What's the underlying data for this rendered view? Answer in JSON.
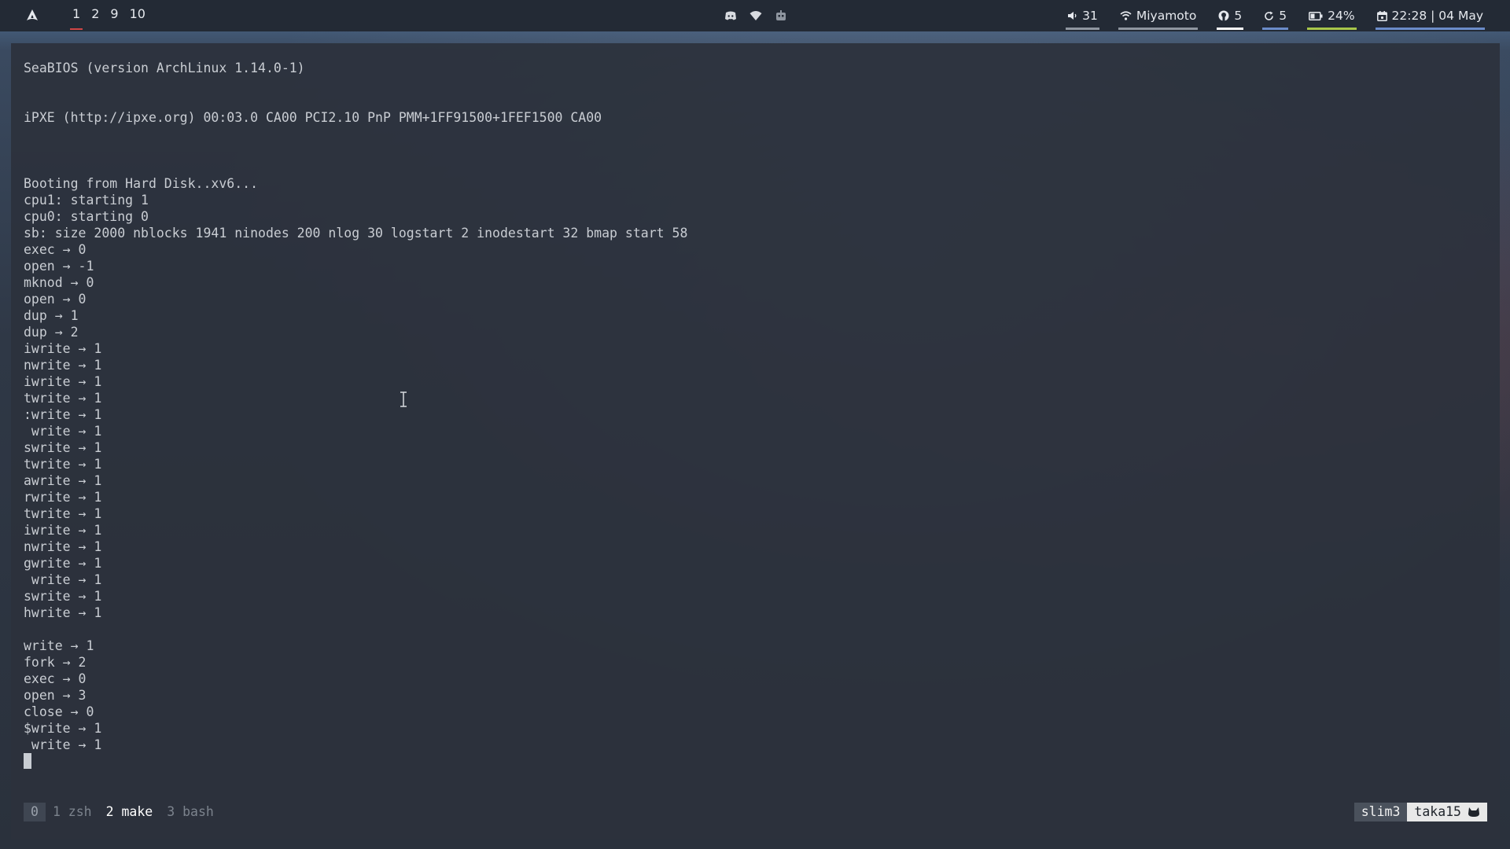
{
  "topbar": {
    "logo_icon": "arch-linux-icon",
    "workspaces": [
      {
        "label": "1",
        "active": true
      },
      {
        "label": "2",
        "active": false
      },
      {
        "label": "9",
        "active": false
      },
      {
        "label": "10",
        "active": false
      }
    ],
    "tray_icons": [
      "discord-icon",
      "wifi-tray-icon",
      "robot-icon"
    ],
    "volume": {
      "icon": "speaker-icon",
      "value": "31",
      "color": "#8f96a0"
    },
    "wifi": {
      "icon": "wifi-icon",
      "value": "Miyamoto",
      "color": "#8f96a0"
    },
    "github": {
      "icon": "github-icon",
      "value": "5",
      "color": "#ffffff"
    },
    "updates": {
      "icon": "refresh-icon",
      "value": "5",
      "color": "#6b8cc9"
    },
    "battery": {
      "icon": "battery-icon",
      "value": "24%",
      "color": "#a8c64a"
    },
    "clock": {
      "icon": "calendar-icon",
      "value": "22:28 | 04 May",
      "color": "#6b8cc9"
    }
  },
  "terminal": {
    "lines": [
      "SeaBIOS (version ArchLinux 1.14.0-1)",
      "",
      "",
      "iPXE (http://ipxe.org) 00:03.0 CA00 PCI2.10 PnP PMM+1FF91500+1FEF1500 CA00",
      "",
      "",
      "",
      "Booting from Hard Disk..xv6...",
      "cpu1: starting 1",
      "cpu0: starting 0",
      "sb: size 2000 nblocks 1941 ninodes 200 nlog 30 logstart 2 inodestart 32 bmap start 58",
      "exec → 0",
      "open → -1",
      "mknod → 0",
      "open → 0",
      "dup → 1",
      "dup → 2",
      "iwrite → 1",
      "nwrite → 1",
      "iwrite → 1",
      "twrite → 1",
      ":write → 1",
      " write → 1",
      "swrite → 1",
      "twrite → 1",
      "awrite → 1",
      "rwrite → 1",
      "twrite → 1",
      "iwrite → 1",
      "nwrite → 1",
      "gwrite → 1",
      " write → 1",
      "swrite → 1",
      "hwrite → 1",
      "",
      "write → 1",
      "fork → 2",
      "exec → 0",
      "open → 3",
      "close → 0",
      "$write → 1",
      " write → 1"
    ]
  },
  "tmux": {
    "windows": [
      {
        "label": "0",
        "state": "index"
      },
      {
        "label": "1 zsh",
        "state": "inactive"
      },
      {
        "label": "2 make",
        "state": "current"
      },
      {
        "label": "3 bash",
        "state": "inactive"
      }
    ],
    "session": "slim3",
    "host": "taka15",
    "host_icon": "cat-icon"
  }
}
